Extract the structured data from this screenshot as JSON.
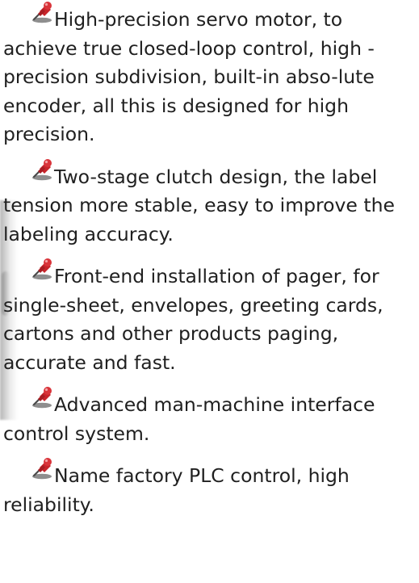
{
  "features": [
    {
      "icon": "pushpin-icon",
      "text": "High-precision servo motor, to achieve true closed-loop control, high -precision subdivision, built-in abso-lute encoder, all this is designed for high precision."
    },
    {
      "icon": "pushpin-icon",
      "text": "Two-stage clutch design, the label tension more stable, easy to improve the labeling accuracy."
    },
    {
      "icon": "pushpin-icon",
      "text": "Front-end installation of pager, for single-sheet, envelopes, greeting cards, cartons and other products paging, accurate and fast."
    },
    {
      "icon": "pushpin-icon",
      "text": "Advanced man-machine interface control system."
    },
    {
      "icon": "pushpin-icon",
      "text": "Name factory PLC control, high reliability."
    }
  ],
  "colors": {
    "pin_red": "#c8242a",
    "pin_gray": "#6b6b6b",
    "text": "#202020"
  }
}
